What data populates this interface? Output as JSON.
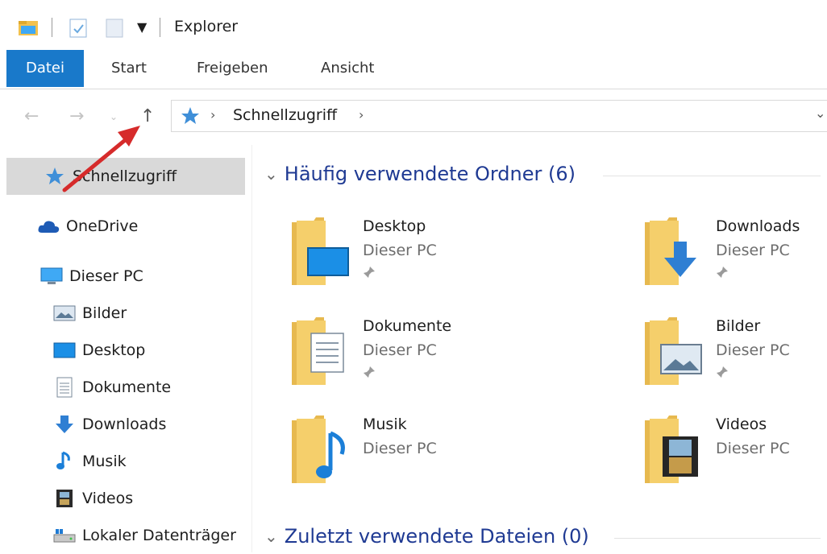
{
  "window": {
    "title": "Explorer"
  },
  "ribbon": {
    "tabs": [
      "Datei",
      "Start",
      "Freigeben",
      "Ansicht"
    ]
  },
  "address": {
    "crumbs": [
      "Schnellzugriff"
    ]
  },
  "nav": {
    "items": [
      {
        "label": "Schnellzugriff",
        "icon": "quick-access-star-icon"
      },
      {
        "label": "OneDrive",
        "icon": "onedrive-cloud-icon"
      },
      {
        "label": "Dieser PC",
        "icon": "this-pc-monitor-icon"
      },
      {
        "label": "Bilder",
        "icon": "pictures-icon"
      },
      {
        "label": "Desktop",
        "icon": "desktop-icon"
      },
      {
        "label": "Dokumente",
        "icon": "documents-icon"
      },
      {
        "label": "Downloads",
        "icon": "downloads-arrow-icon"
      },
      {
        "label": "Musik",
        "icon": "music-note-icon"
      },
      {
        "label": "Videos",
        "icon": "video-film-icon"
      },
      {
        "label": "Lokaler Datenträger",
        "icon": "local-drive-icon"
      }
    ]
  },
  "main": {
    "frequent_header": "Häufig verwendete Ordner (6)",
    "recent_header": "Zuletzt verwendete Dateien (0)",
    "folders": [
      {
        "name": "Desktop",
        "location": "Dieser PC",
        "pinned": true
      },
      {
        "name": "Downloads",
        "location": "Dieser PC",
        "pinned": true
      },
      {
        "name": "Dokumente",
        "location": "Dieser PC",
        "pinned": true
      },
      {
        "name": "Bilder",
        "location": "Dieser PC",
        "pinned": true
      },
      {
        "name": "Musik",
        "location": "Dieser PC",
        "pinned": false
      },
      {
        "name": "Videos",
        "location": "Dieser PC",
        "pinned": false
      }
    ]
  },
  "colors": {
    "accent": "#1979ca",
    "header_text": "#1f3a93",
    "folder": "#f5cf6b",
    "annotation_arrow": "#d62b2b"
  }
}
